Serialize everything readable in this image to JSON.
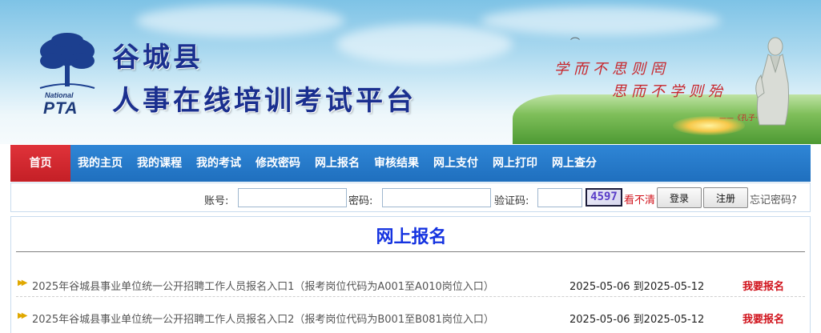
{
  "banner": {
    "title_line1": "谷城县",
    "title_line2": "人事在线培训考试平台",
    "logo_national": "National",
    "logo_pta": "PTA",
    "motto_line1": "学而不思则罔",
    "motto_line2": "思而不学则殆",
    "motto_source": "——《孔子·论语》"
  },
  "nav": {
    "items": [
      {
        "label": "首页"
      },
      {
        "label": "我的主页"
      },
      {
        "label": "我的课程"
      },
      {
        "label": "我的考试"
      },
      {
        "label": "修改密码"
      },
      {
        "label": "网上报名"
      },
      {
        "label": "审核结果"
      },
      {
        "label": "网上支付"
      },
      {
        "label": "网上打印"
      },
      {
        "label": "网上查分"
      }
    ]
  },
  "login": {
    "account_label": "账号:",
    "password_label": "密码:",
    "captcha_label": "验证码:",
    "captcha_code": "4597",
    "refresh_label": "看不清",
    "login_button": "登录",
    "register_button": "注册",
    "forgot_label": "忘记密码?"
  },
  "main": {
    "section_title": "网上报名",
    "entries": [
      {
        "title": "2025年谷城县事业单位统一公开招聘工作人员报名入口1（报考岗位代码为A001至A010岗位入口）",
        "date_range": "2025-05-06 到2025-05-12",
        "action": "我要报名"
      },
      {
        "title": "2025年谷城县事业单位统一公开招聘工作人员报名入口2（报考岗位代码为B001至B081岗位入口）",
        "date_range": "2025-05-06 到2025-05-12",
        "action": "我要报名"
      }
    ]
  }
}
